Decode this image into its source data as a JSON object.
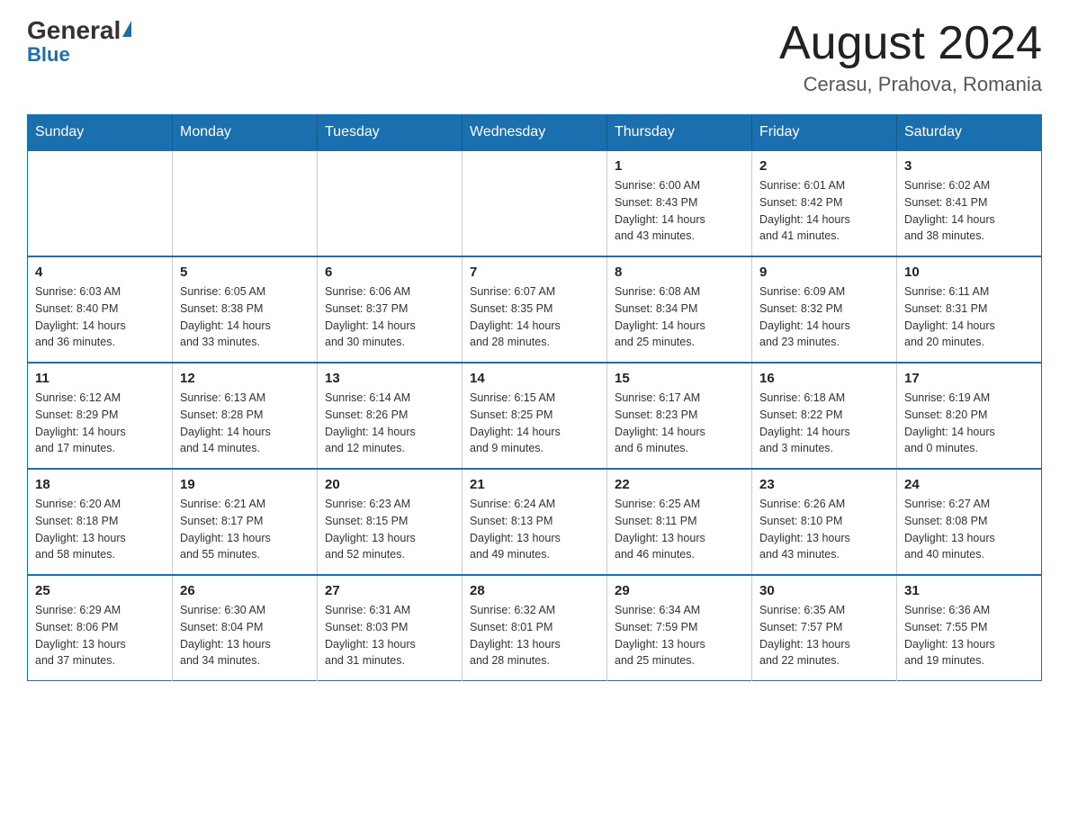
{
  "header": {
    "logo_general": "General",
    "logo_blue": "Blue",
    "title": "August 2024",
    "subtitle": "Cerasu, Prahova, Romania"
  },
  "calendar": {
    "days_of_week": [
      "Sunday",
      "Monday",
      "Tuesday",
      "Wednesday",
      "Thursday",
      "Friday",
      "Saturday"
    ],
    "weeks": [
      [
        {
          "day": "",
          "info": ""
        },
        {
          "day": "",
          "info": ""
        },
        {
          "day": "",
          "info": ""
        },
        {
          "day": "",
          "info": ""
        },
        {
          "day": "1",
          "info": "Sunrise: 6:00 AM\nSunset: 8:43 PM\nDaylight: 14 hours\nand 43 minutes."
        },
        {
          "day": "2",
          "info": "Sunrise: 6:01 AM\nSunset: 8:42 PM\nDaylight: 14 hours\nand 41 minutes."
        },
        {
          "day": "3",
          "info": "Sunrise: 6:02 AM\nSunset: 8:41 PM\nDaylight: 14 hours\nand 38 minutes."
        }
      ],
      [
        {
          "day": "4",
          "info": "Sunrise: 6:03 AM\nSunset: 8:40 PM\nDaylight: 14 hours\nand 36 minutes."
        },
        {
          "day": "5",
          "info": "Sunrise: 6:05 AM\nSunset: 8:38 PM\nDaylight: 14 hours\nand 33 minutes."
        },
        {
          "day": "6",
          "info": "Sunrise: 6:06 AM\nSunset: 8:37 PM\nDaylight: 14 hours\nand 30 minutes."
        },
        {
          "day": "7",
          "info": "Sunrise: 6:07 AM\nSunset: 8:35 PM\nDaylight: 14 hours\nand 28 minutes."
        },
        {
          "day": "8",
          "info": "Sunrise: 6:08 AM\nSunset: 8:34 PM\nDaylight: 14 hours\nand 25 minutes."
        },
        {
          "day": "9",
          "info": "Sunrise: 6:09 AM\nSunset: 8:32 PM\nDaylight: 14 hours\nand 23 minutes."
        },
        {
          "day": "10",
          "info": "Sunrise: 6:11 AM\nSunset: 8:31 PM\nDaylight: 14 hours\nand 20 minutes."
        }
      ],
      [
        {
          "day": "11",
          "info": "Sunrise: 6:12 AM\nSunset: 8:29 PM\nDaylight: 14 hours\nand 17 minutes."
        },
        {
          "day": "12",
          "info": "Sunrise: 6:13 AM\nSunset: 8:28 PM\nDaylight: 14 hours\nand 14 minutes."
        },
        {
          "day": "13",
          "info": "Sunrise: 6:14 AM\nSunset: 8:26 PM\nDaylight: 14 hours\nand 12 minutes."
        },
        {
          "day": "14",
          "info": "Sunrise: 6:15 AM\nSunset: 8:25 PM\nDaylight: 14 hours\nand 9 minutes."
        },
        {
          "day": "15",
          "info": "Sunrise: 6:17 AM\nSunset: 8:23 PM\nDaylight: 14 hours\nand 6 minutes."
        },
        {
          "day": "16",
          "info": "Sunrise: 6:18 AM\nSunset: 8:22 PM\nDaylight: 14 hours\nand 3 minutes."
        },
        {
          "day": "17",
          "info": "Sunrise: 6:19 AM\nSunset: 8:20 PM\nDaylight: 14 hours\nand 0 minutes."
        }
      ],
      [
        {
          "day": "18",
          "info": "Sunrise: 6:20 AM\nSunset: 8:18 PM\nDaylight: 13 hours\nand 58 minutes."
        },
        {
          "day": "19",
          "info": "Sunrise: 6:21 AM\nSunset: 8:17 PM\nDaylight: 13 hours\nand 55 minutes."
        },
        {
          "day": "20",
          "info": "Sunrise: 6:23 AM\nSunset: 8:15 PM\nDaylight: 13 hours\nand 52 minutes."
        },
        {
          "day": "21",
          "info": "Sunrise: 6:24 AM\nSunset: 8:13 PM\nDaylight: 13 hours\nand 49 minutes."
        },
        {
          "day": "22",
          "info": "Sunrise: 6:25 AM\nSunset: 8:11 PM\nDaylight: 13 hours\nand 46 minutes."
        },
        {
          "day": "23",
          "info": "Sunrise: 6:26 AM\nSunset: 8:10 PM\nDaylight: 13 hours\nand 43 minutes."
        },
        {
          "day": "24",
          "info": "Sunrise: 6:27 AM\nSunset: 8:08 PM\nDaylight: 13 hours\nand 40 minutes."
        }
      ],
      [
        {
          "day": "25",
          "info": "Sunrise: 6:29 AM\nSunset: 8:06 PM\nDaylight: 13 hours\nand 37 minutes."
        },
        {
          "day": "26",
          "info": "Sunrise: 6:30 AM\nSunset: 8:04 PM\nDaylight: 13 hours\nand 34 minutes."
        },
        {
          "day": "27",
          "info": "Sunrise: 6:31 AM\nSunset: 8:03 PM\nDaylight: 13 hours\nand 31 minutes."
        },
        {
          "day": "28",
          "info": "Sunrise: 6:32 AM\nSunset: 8:01 PM\nDaylight: 13 hours\nand 28 minutes."
        },
        {
          "day": "29",
          "info": "Sunrise: 6:34 AM\nSunset: 7:59 PM\nDaylight: 13 hours\nand 25 minutes."
        },
        {
          "day": "30",
          "info": "Sunrise: 6:35 AM\nSunset: 7:57 PM\nDaylight: 13 hours\nand 22 minutes."
        },
        {
          "day": "31",
          "info": "Sunrise: 6:36 AM\nSunset: 7:55 PM\nDaylight: 13 hours\nand 19 minutes."
        }
      ]
    ]
  }
}
